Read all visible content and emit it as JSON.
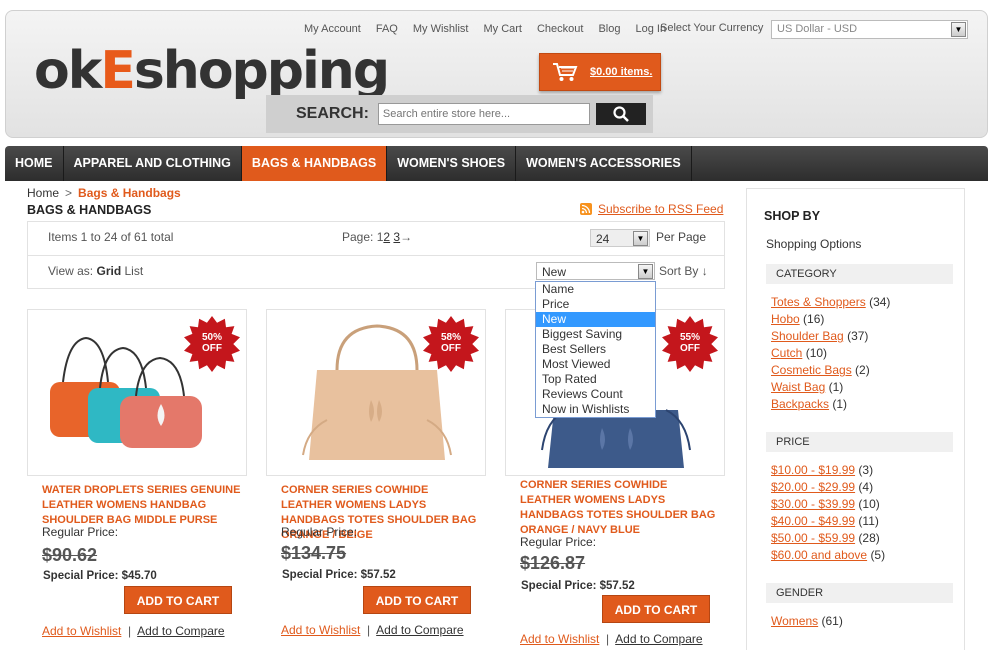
{
  "header": {
    "logo_prefix": "ok",
    "logo_e": "E",
    "logo_suffix": "shopping",
    "top_links": [
      "My Account",
      "FAQ",
      "My Wishlist",
      "My Cart",
      "Checkout",
      "Blog",
      "Log In"
    ],
    "currency_label": "Select Your Currency",
    "currency_value": "US Dollar - USD",
    "cart_label": "$0.00 items.",
    "search_label": "SEARCH:",
    "search_placeholder": "Search entire store here..."
  },
  "nav": [
    "HOME",
    "APPAREL AND CLOTHING",
    "BAGS & HANDBAGS",
    "WOMEN'S SHOES",
    "WOMEN'S ACCESSORIES"
  ],
  "breadcrumb": {
    "home": "Home",
    "sep": ">",
    "current": "Bags & Handbags"
  },
  "page_title": "BAGS & HANDBAGS",
  "rss_label": "Subscribe to RSS Feed",
  "toolbar": {
    "items_count": "Items 1 to 24 of 61 total",
    "page_label": "Page:",
    "pages": [
      "1",
      "2",
      "3"
    ],
    "next_arrow": "→",
    "per_page_value": "24",
    "per_page_label": "Per Page",
    "view_as_label": "View as:",
    "view_grid": "Grid",
    "view_list": "List",
    "sort_value": "New",
    "sort_label": "Sort By",
    "sort_arrow": "↓"
  },
  "sort_options": [
    "Name",
    "Price",
    "New",
    "Biggest Saving",
    "Best Sellers",
    "Most Viewed",
    "Top Rated",
    "Reviews Count",
    "Now in Wishlists"
  ],
  "products": [
    {
      "badge_pct": "50%",
      "badge_off": "OFF",
      "name": "WATER DROPLETS SERIES GENUINE LEATHER WOMENS HANDBAG SHOULDER BAG MIDDLE PURSE",
      "regular_label": "Regular Price:",
      "old_price": "$90.62",
      "special": "Special Price: $45.70",
      "add_to_cart": "ADD TO CART",
      "wishlist": "Add to Wishlist",
      "compare": "Add to Compare"
    },
    {
      "badge_pct": "58%",
      "badge_off": "OFF",
      "name": "CORNER SERIES COWHIDE LEATHER WOMENS LADYS HANDBAGS TOTES SHOULDER BAG ORANGE / BEIGE",
      "regular_label": "Regular Price:",
      "old_price": "$134.75",
      "special": "Special Price: $57.52",
      "add_to_cart": "ADD TO CART",
      "wishlist": "Add to Wishlist",
      "compare": "Add to Compare"
    },
    {
      "badge_pct": "55%",
      "badge_off": "OFF",
      "name": "CORNER SERIES COWHIDE LEATHER WOMENS LADYS HANDBAGS TOTES SHOULDER BAG ORANGE / NAVY BLUE",
      "regular_label": "Regular Price:",
      "old_price": "$126.87",
      "special": "Special Price: $57.52",
      "add_to_cart": "ADD TO CART",
      "wishlist": "Add to Wishlist",
      "compare": "Add to Compare"
    }
  ],
  "link_sep": "|",
  "sidebar": {
    "title": "SHOP BY",
    "subtitle": "Shopping Options",
    "category_head": "CATEGORY",
    "categories": [
      {
        "name": "Totes & Shoppers",
        "count": "(34)"
      },
      {
        "name": "Hobo",
        "count": "(16)"
      },
      {
        "name": "Shoulder Bag",
        "count": "(37)"
      },
      {
        "name": "Cutch",
        "count": "(10)"
      },
      {
        "name": "Cosmetic Bags",
        "count": "(2)"
      },
      {
        "name": "Waist Bag",
        "count": "(1)"
      },
      {
        "name": "Backpacks",
        "count": "(1)"
      }
    ],
    "price_head": "PRICE",
    "prices": [
      {
        "name": "$10.00 - $19.99",
        "count": "(3)"
      },
      {
        "name": "$20.00 - $29.99",
        "count": "(4)"
      },
      {
        "name": "$30.00 - $39.99",
        "count": "(10)"
      },
      {
        "name": "$40.00 - $49.99",
        "count": "(11)"
      },
      {
        "name": "$50.00 - $59.99",
        "count": "(28)"
      },
      {
        "name": "$60.00 and above",
        "count": "(5)"
      }
    ],
    "gender_head": "GENDER",
    "genders": [
      {
        "name": "Womens",
        "count": "(61)"
      }
    ]
  },
  "icons": {
    "cart": "cart-icon",
    "search": "search-icon",
    "rss": "rss-icon",
    "dropdown": "chevron-down-icon"
  },
  "colors": {
    "accent": "#e05a1c",
    "badge": "#c4161c",
    "nav_bg": "#333333"
  }
}
